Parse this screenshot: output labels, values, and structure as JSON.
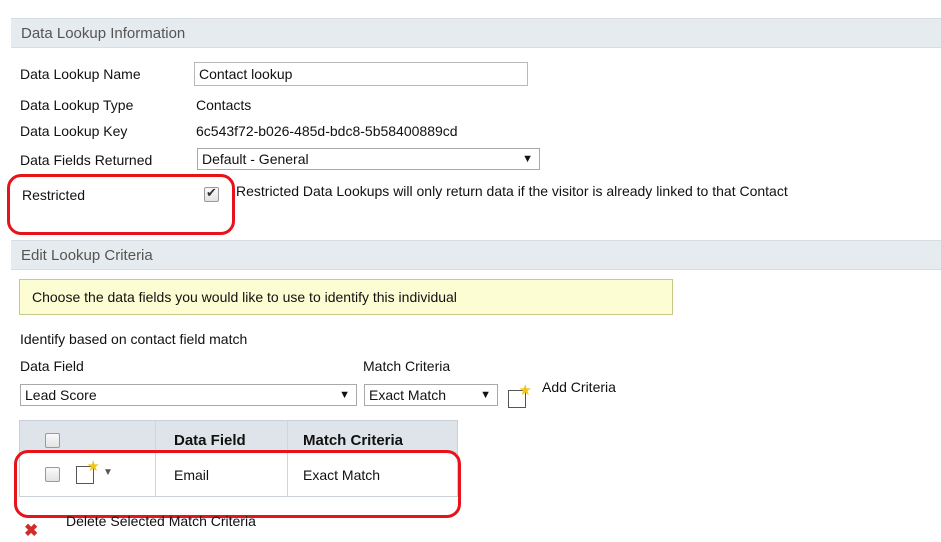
{
  "info_section": {
    "title": "Data Lookup Information",
    "name_label": "Data Lookup Name",
    "name_value": "Contact lookup",
    "type_label": "Data Lookup Type",
    "type_value": "Contacts",
    "key_label": "Data Lookup Key",
    "key_value": "6c543f72-b026-485d-bdc8-5b58400889cd",
    "fields_label": "Data Fields Returned",
    "fields_value": "Default - General",
    "restricted_label": "Restricted",
    "restricted_checked": true,
    "restricted_desc": "Restricted Data Lookups will only return data if the visitor is already linked to that Contact"
  },
  "criteria_section": {
    "title": "Edit Lookup Criteria",
    "info_text": "Choose the data fields you would like to use to identify this individual",
    "identify_label": "Identify based on contact field match",
    "data_field_label": "Data Field",
    "data_field_value": "Lead Score",
    "match_label": "Match Criteria",
    "match_value": "Exact Match",
    "add_label": "Add Criteria",
    "add_icon": "note-star-icon"
  },
  "criteria_table": {
    "headers": [
      "",
      "Data Field",
      "Match Criteria"
    ],
    "rows": [
      {
        "data_field": "Email",
        "match": "Exact Match"
      }
    ]
  },
  "delete_label": "Delete Selected Match Criteria",
  "colors": {
    "header_bg": "#e6ebf0",
    "highlight": "#e8121b",
    "info_bg": "#fdfdd3"
  }
}
